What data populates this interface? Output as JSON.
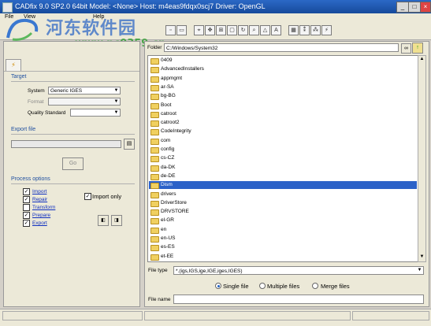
{
  "window": {
    "title": "CADfix 9.0 SP2.0 64bit  Model: <None>  Host: m4eas9fdqx0scj7  Driver: OpenGL"
  },
  "menubar": {
    "items": [
      "File",
      "View",
      "Help"
    ]
  },
  "watermark": {
    "site_name": "河东软件园",
    "url": "www.pc0359.cn"
  },
  "left": {
    "tab_icon": "lightning-icon",
    "target": {
      "heading": "Target",
      "system_label": "System",
      "system_value": "Generic IGES",
      "format_label": "Format",
      "format_value": "",
      "quality_label": "Quality Standard",
      "quality_value": ""
    },
    "export_file": {
      "heading": "Export file",
      "path_value": "",
      "go_label": "Go"
    },
    "process": {
      "heading": "Process options",
      "options": [
        {
          "label": "Import",
          "checked": true
        },
        {
          "label": "Repair",
          "checked": true
        },
        {
          "label": "Transform",
          "checked": false
        },
        {
          "label": "Prepare",
          "checked": true
        },
        {
          "label": "Export",
          "checked": true
        }
      ],
      "import_only_label": "Import only",
      "import_only_checked": true
    }
  },
  "right": {
    "folder_label": "Folder",
    "folder_value": "C:/Windows/System32",
    "files": [
      "0409",
      "AdvancedInstallers",
      "appmgmt",
      "ar-SA",
      "bg-BG",
      "Boot",
      "catroot",
      "catroot2",
      "CodeIntegrity",
      "com",
      "config",
      "cs-CZ",
      "da-DK",
      "de-DE",
      "Dism",
      "drivers",
      "DriverStore",
      "DRVSTORE",
      "el-GR",
      "en",
      "en-US",
      "es-ES",
      "et-EE"
    ],
    "selected_file": "Dism",
    "filetype_label": "File type",
    "filetype_value": "*.(igs,IGS,ige,IGE,iges,IGES)",
    "modes": [
      {
        "label": "Single file",
        "selected": true
      },
      {
        "label": "Multiple files",
        "selected": false
      },
      {
        "label": "Merge files",
        "selected": false
      }
    ],
    "filename_label": "File name",
    "filename_value": ""
  }
}
